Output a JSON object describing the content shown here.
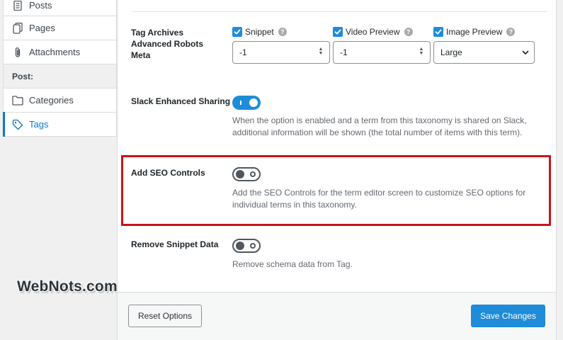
{
  "sidebar": {
    "items": [
      {
        "label": "Posts",
        "icon": "document-icon"
      },
      {
        "label": "Pages",
        "icon": "pages-icon"
      },
      {
        "label": "Attachments",
        "icon": "paperclip-icon"
      }
    ],
    "section_label": "Post:",
    "post_items": [
      {
        "label": "Categories",
        "icon": "folder-icon"
      },
      {
        "label": "Tags",
        "icon": "tag-icon",
        "active": true
      }
    ]
  },
  "watermark": "WebNots.com",
  "robots_meta": {
    "label": "Tag Archives Advanced Robots Meta",
    "snippet": {
      "label": "Snippet",
      "checked": true,
      "value": "-1"
    },
    "video_preview": {
      "label": "Video Preview",
      "checked": true,
      "value": "-1"
    },
    "image_preview": {
      "label": "Image Preview",
      "checked": true,
      "value": "Large"
    },
    "help_glyph": "?"
  },
  "slack_sharing": {
    "label": "Slack Enhanced Sharing",
    "enabled": true,
    "description": "When the option is enabled and a term from this taxonomy is shared on Slack, additional information will be shown (the total number of items with this term)."
  },
  "seo_controls": {
    "label": "Add SEO Controls",
    "enabled": false,
    "description": "Add the SEO Controls for the term editor screen to customize SEO options for individual terms in this taxonomy."
  },
  "remove_snippet": {
    "label": "Remove Snippet Data",
    "enabled": false,
    "description": "Remove schema data from Tag."
  },
  "footer": {
    "reset_label": "Reset Options",
    "save_label": "Save Changes"
  },
  "colors": {
    "accent": "#1e8cd8",
    "active_link": "#0a7ac0",
    "highlight_border": "#c8141a"
  }
}
